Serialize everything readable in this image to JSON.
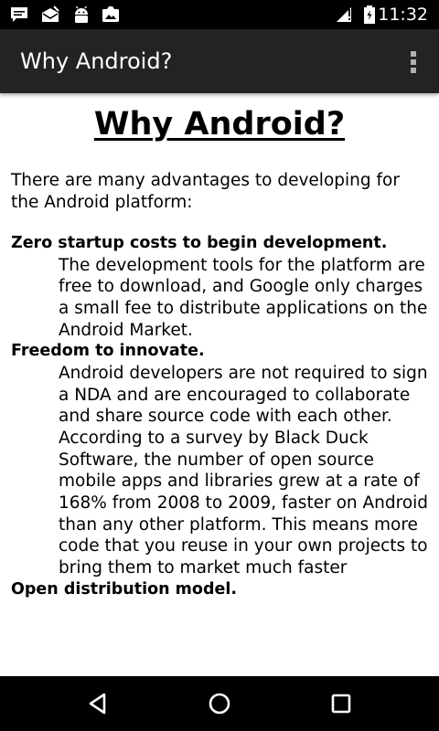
{
  "status_bar": {
    "time": "11:32",
    "notification_icons": [
      "chat-notification-icon",
      "mail-notification-icon",
      "android-debug-icon",
      "photo-notification-icon"
    ],
    "system_icons": [
      "signal-icon",
      "battery-icon"
    ]
  },
  "action_bar": {
    "title": "Why Android?",
    "overflow_icon": "overflow-menu-icon"
  },
  "content": {
    "heading": "Why Android?",
    "intro": "There are many advantages to developing for the Android platform:",
    "items": [
      {
        "term": "Zero startup costs to begin development.",
        "description": "The development tools for the platform are free to download, and Google only charges a small fee to distribute applications on the Android Market."
      },
      {
        "term": "Freedom to innovate.",
        "description": "Android developers are not required to sign a NDA and are encouraged to collaborate and share source code with each other. According to a survey by Black Duck Software, the number of open source mobile apps and libraries grew at a rate of 168% from 2008 to 2009, faster on Android than any other platform. This means more code that you reuse in your own projects to bring them to market much faster"
      },
      {
        "term": "Open distribution model."
      }
    ]
  },
  "nav_bar": {
    "icons": [
      "back-icon",
      "home-icon",
      "recent-apps-icon"
    ]
  },
  "colors": {
    "status_bar": "#000000",
    "action_bar": "#232323",
    "content_background": "#ffffff",
    "nav_bar": "#000000"
  }
}
